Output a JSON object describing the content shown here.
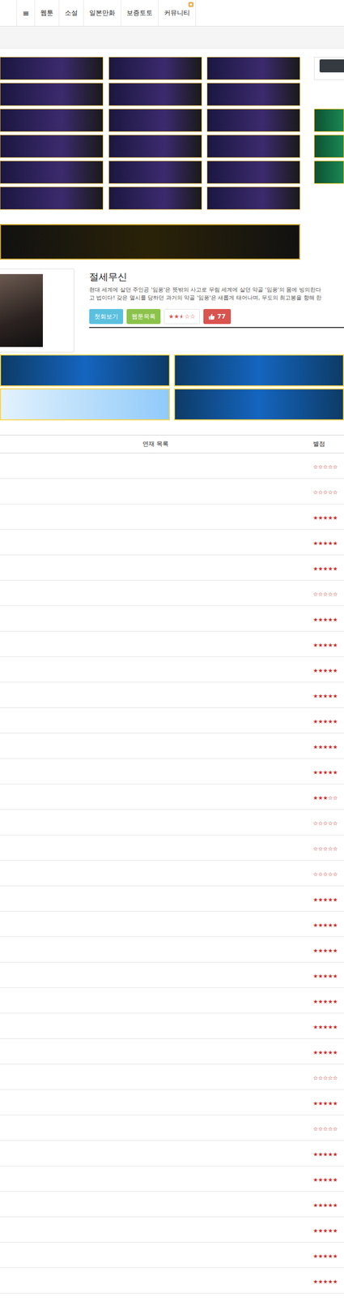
{
  "nav": {
    "menu_icon": "≡",
    "items": [
      "웹툰",
      "소설",
      "일본만화",
      "보증토토",
      "커뮤니티"
    ]
  },
  "series": {
    "title": "절세무신",
    "description": [
      "현대 세계에 살던 주인공 '임풍'은 뜻밖의 사고로 무림 세계에 살던 약골 '임풍'의 몸에 빙의한다",
      "고 법이다! 갖은 멸시를 당하던 과거의 약골 '임풍'은 새롭게 태어나며, 무도의 최고봉을 향해 한"
    ],
    "buttons": [
      "첫회보기",
      "웹툰목록"
    ],
    "stars": 2.5,
    "likes": "77"
  },
  "star_glyphs": {
    "full": "★",
    "empty": "☆"
  },
  "episode_table": {
    "columns": [
      "연재 목록",
      "별점"
    ],
    "rows": [
      {
        "stars": 0
      },
      {
        "stars": 0
      },
      {
        "stars": 5
      },
      {
        "stars": 5
      },
      {
        "stars": 5
      },
      {
        "stars": 0
      },
      {
        "stars": 5
      },
      {
        "stars": 5
      },
      {
        "stars": 5
      },
      {
        "stars": 5
      },
      {
        "stars": 5
      },
      {
        "stars": 5
      },
      {
        "stars": 5
      },
      {
        "stars": 3
      },
      {
        "stars": 0
      },
      {
        "stars": 0
      },
      {
        "stars": 0
      },
      {
        "stars": 5
      },
      {
        "stars": 5
      },
      {
        "stars": 5
      },
      {
        "stars": 5
      },
      {
        "stars": 5
      },
      {
        "stars": 5
      },
      {
        "stars": 5
      },
      {
        "stars": 0
      },
      {
        "stars": 5
      },
      {
        "stars": 0
      },
      {
        "stars": 5
      },
      {
        "stars": 5
      },
      {
        "stars": 5
      },
      {
        "stars": 5
      },
      {
        "stars": 5
      },
      {
        "stars": 5
      }
    ]
  }
}
